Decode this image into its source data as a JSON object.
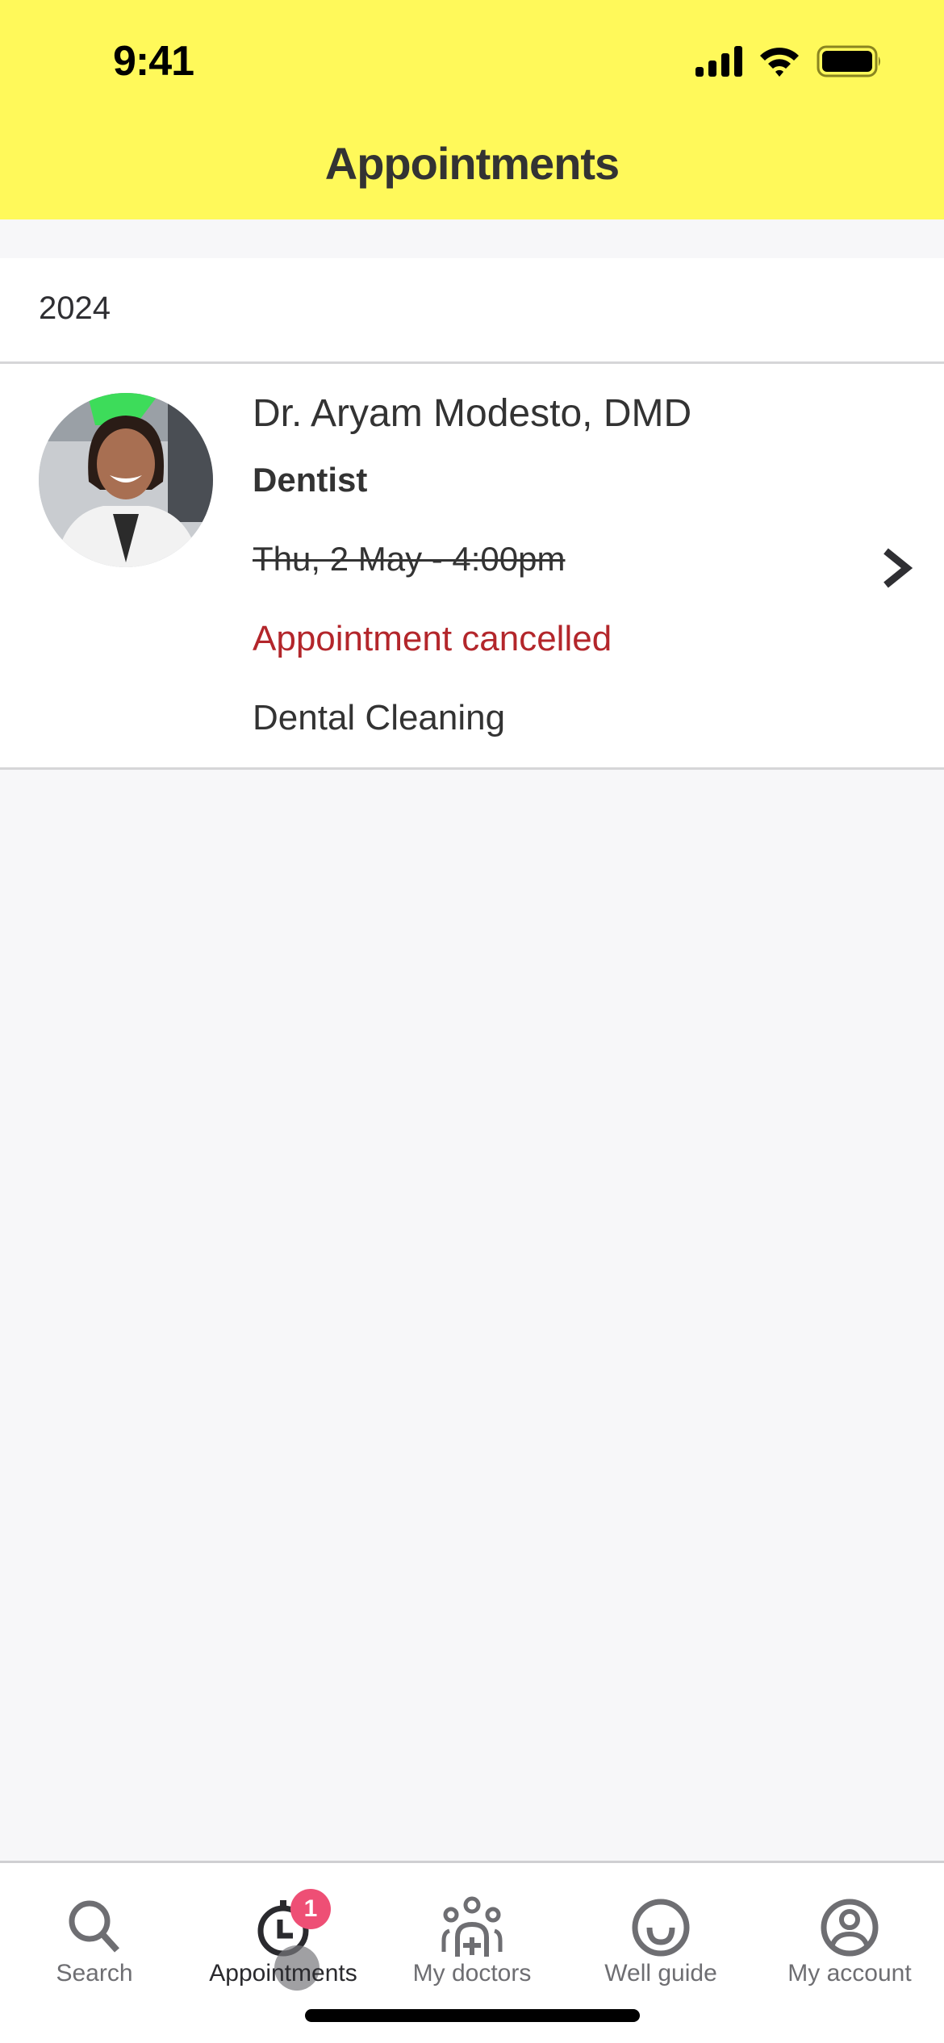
{
  "status_bar": {
    "time": "9:41"
  },
  "header": {
    "title": "Appointments",
    "background": "#FFF95A"
  },
  "year_section": {
    "year": "2024"
  },
  "appointments": [
    {
      "doctor_name": "Dr. Aryam Modesto, DMD",
      "specialty": "Dentist",
      "datetime": "Thu, 2 May - 4:00pm",
      "status": "Appointment cancelled",
      "status_color": "#B3262B",
      "reason": "Dental Cleaning",
      "avatar": "doctor-photo"
    }
  ],
  "tabbar": {
    "items": [
      {
        "label": "Search",
        "icon": "search-icon",
        "active": false
      },
      {
        "label": "Appointments",
        "icon": "clock-icon",
        "active": true,
        "badge": "1"
      },
      {
        "label": "My doctors",
        "icon": "doctors-group-icon",
        "active": false
      },
      {
        "label": "Well guide",
        "icon": "smile-icon",
        "active": false
      },
      {
        "label": "My account",
        "icon": "account-icon",
        "active": false
      }
    ],
    "badge_color": "#EE4F75"
  }
}
